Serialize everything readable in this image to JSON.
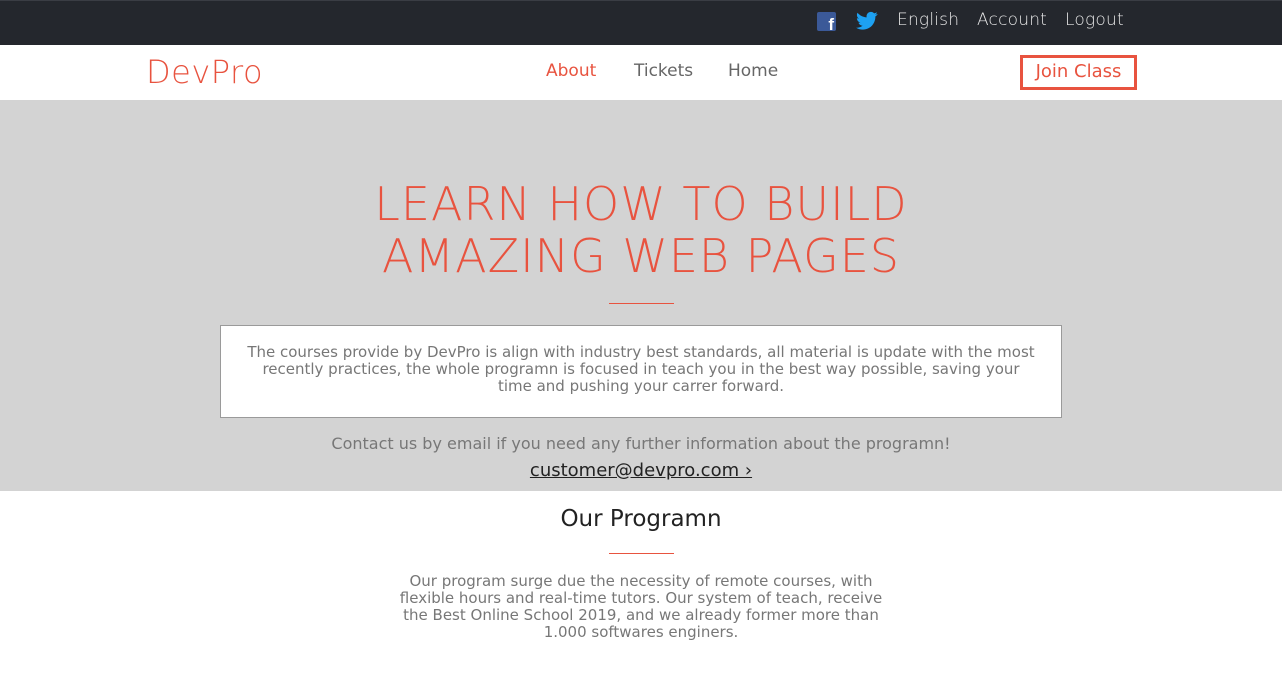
{
  "topbar": {
    "facebook_icon": "facebook-icon",
    "twitter_icon": "twitter-icon",
    "language": "English",
    "account": "Account",
    "logout": "Logout"
  },
  "navbar": {
    "brand": "DevPro",
    "links": [
      "About",
      "Tickets",
      "Home"
    ],
    "active_link": "About",
    "cta": "Join Class"
  },
  "hero": {
    "title_line1": "LEARN HOW TO BUILD",
    "title_line2": "AMAZING WEB PAGES",
    "description": "The courses provide by DevPro is align with industry best standards, all material is update with the most recently practices, the whole programn is focused in teach you in the best way possible, saving your time and pushing your carrer forward.",
    "contact_text": "Contact us by email if you need any further information about the programn!",
    "email": "customer@devpro.com ›"
  },
  "program": {
    "title": "Our Programn",
    "text": "Our program surge due the necessity of remote courses, with flexible hours and real-time tutors. Our system of teach, receive the Best Online School 2019, and we already former more than 1.000 softwares enginers."
  },
  "colors": {
    "accent": "#e8533f",
    "topbar_bg": "#24272d",
    "hero_bg": "#d3d3d3",
    "facebook": "#3b5998",
    "twitter": "#1da1f2"
  }
}
